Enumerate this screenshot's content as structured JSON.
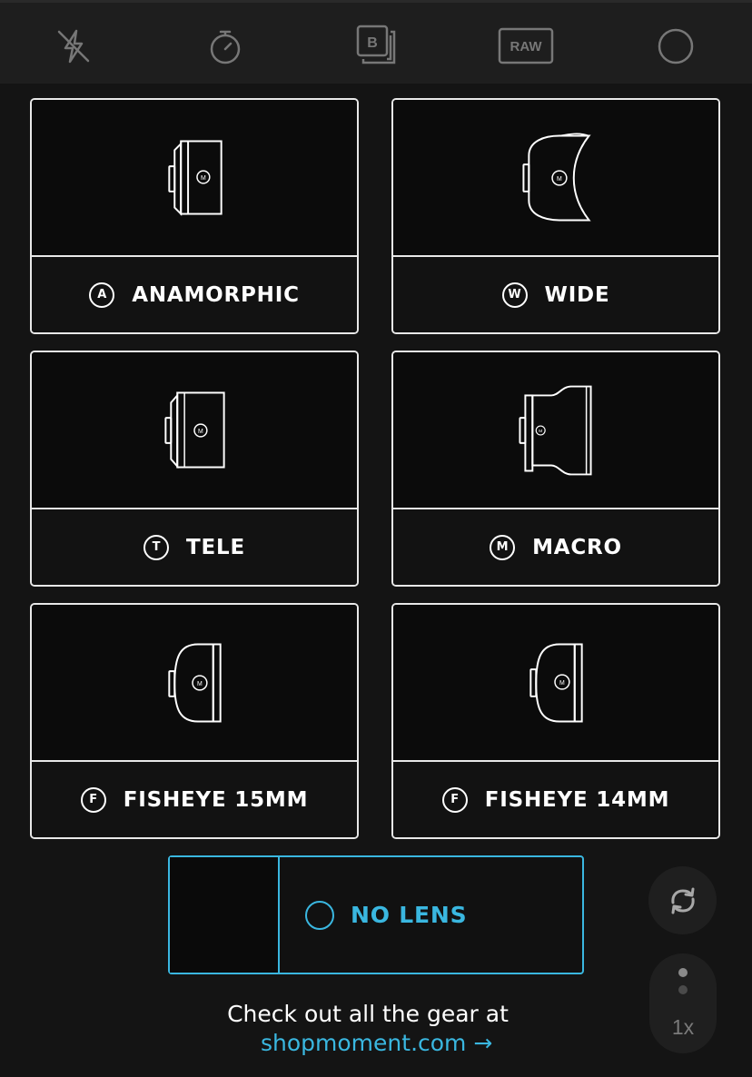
{
  "toolbar": {
    "icons": [
      "flash-off-icon",
      "timer-icon",
      "burst-mode-icon",
      "raw-format-icon",
      "shutter-circle-icon"
    ],
    "raw_label": "RAW",
    "burst_label": "B"
  },
  "lenses": [
    {
      "badge": "A",
      "name": "ANAMORPHIC",
      "icon": "anamorphic-lens-icon"
    },
    {
      "badge": "W",
      "name": "WIDE",
      "icon": "wide-lens-icon"
    },
    {
      "badge": "T",
      "name": "TELE",
      "icon": "tele-lens-icon"
    },
    {
      "badge": "M",
      "name": "MACRO",
      "icon": "macro-lens-icon"
    },
    {
      "badge": "F",
      "name": "FISHEYE 15MM",
      "icon": "fisheye-lens-icon"
    },
    {
      "badge": "F",
      "name": "FISHEYE 14MM",
      "icon": "fisheye-lens-icon"
    }
  ],
  "lens_mark": "M",
  "no_lens": {
    "label": "NO LENS"
  },
  "zoom": {
    "label": "1x"
  },
  "footer": {
    "text": "Check out all the gear at",
    "link": "shopmoment.com →"
  },
  "colors": {
    "accent": "#3ab7e0",
    "background": "#141414",
    "toolbar": "#1e1e1e"
  }
}
